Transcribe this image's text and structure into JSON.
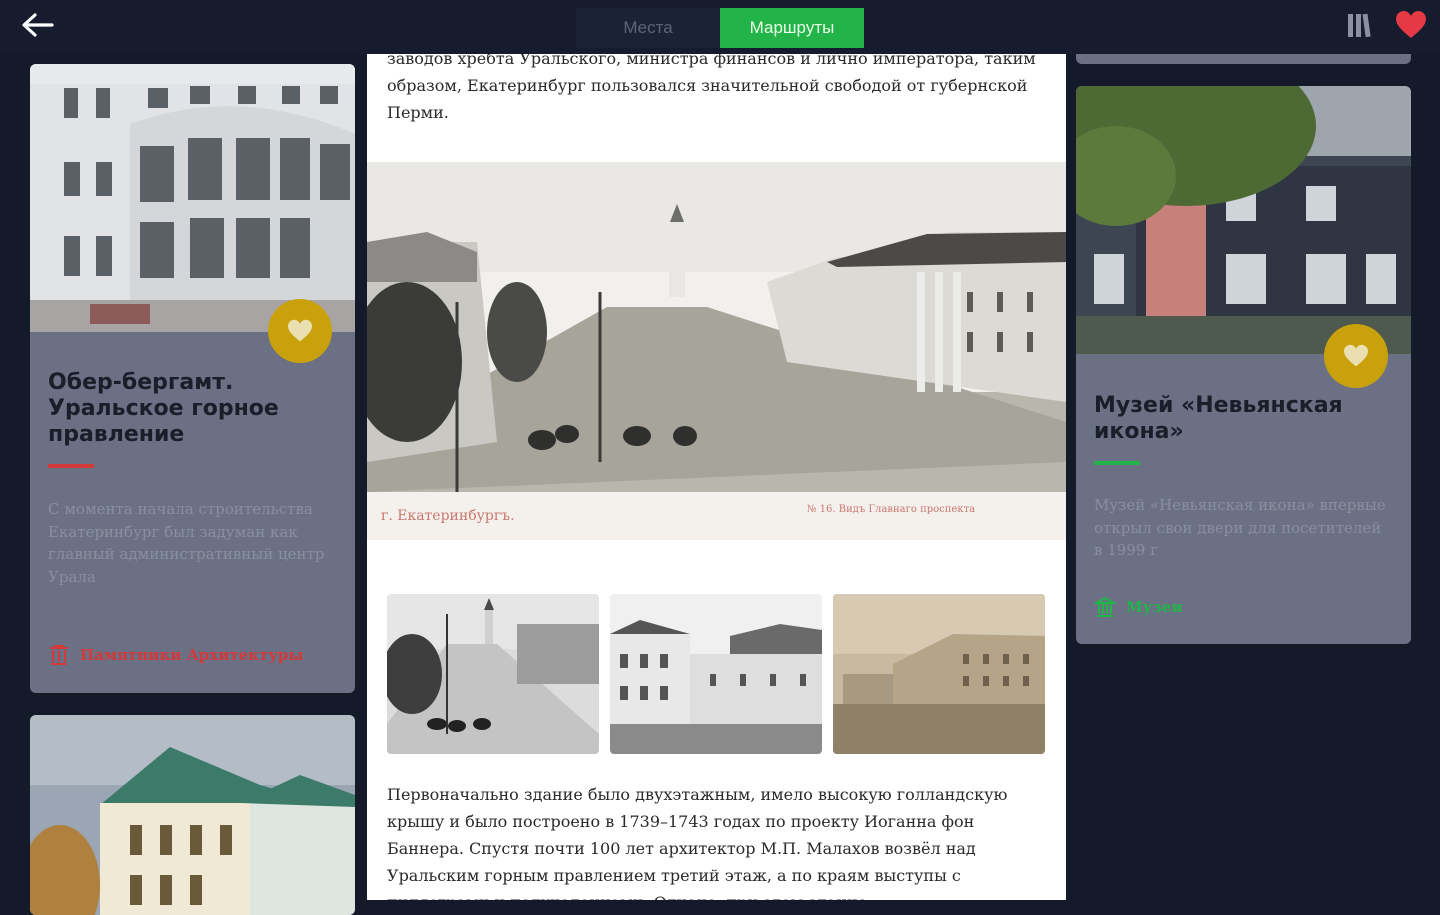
{
  "header": {
    "tabs": [
      {
        "label": "Места",
        "active": false
      },
      {
        "label": "Маршруты",
        "active": true
      }
    ],
    "icons": {
      "back": "arrow-left-icon",
      "library": "library-icon",
      "favorites": "heart-icon"
    },
    "accent_color": "#22b449",
    "favorite_color": "#e53945"
  },
  "cards": [
    {
      "title": "Обер-бергамт. Уральское горное правление",
      "description": "С момента начала строительства Екатеринбург был задуман как главный административный центр Урала",
      "category": "Памятники Архитектуры",
      "category_icon": "monument-icon",
      "accent": "#d43a3a"
    },
    {
      "title": "Музей «Невьянская икона»",
      "description": "Музей «Невьянская икона» впервые открыл свои двери для посетителей в 1999 г",
      "category": "Музеи",
      "category_icon": "museum-icon",
      "accent": "#22b449"
    }
  ],
  "article": {
    "paragraph_top": "заводов хребта Уральского, министра финансов и лично императора, таким образом, Екатеринбург пользовался значительной свободой от губернской Перми.",
    "hero_caption_left": "г. Екатеринбургъ.",
    "hero_caption_right": "№ 16. Видъ Главнаго проспекта",
    "paragraph_bottom": "Первоначально здание было двухэтажным, имело высокую голландскую крышу и было построено в 1739–1743 годах по проекту Иоганна фон Баннера. Спустя почти 100 лет архитектор М.П. Малахов возвёл над Уральским горным правлением третий этаж, а по краям выступы с пилястрами и полуколоннами. Однако, при этом здание"
  }
}
